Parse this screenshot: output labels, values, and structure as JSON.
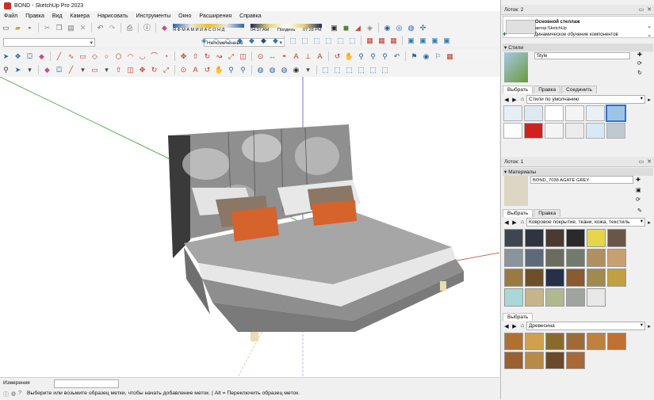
{
  "window": {
    "title": "BOND - SketchUp Pro 2023"
  },
  "menu": [
    "Файл",
    "Правка",
    "Вид",
    "Камера",
    "Нарисовать",
    "Инструменты",
    "Окно",
    "Расширения",
    "Справка"
  ],
  "shadow": {
    "months": "Я Ф М А М И И А С О Н Д",
    "time_left": "04:37 AM",
    "noon": "Полдень",
    "time_right": "07:28 PM"
  },
  "layer_select": "Непомеченные",
  "status": {
    "measure_label": "Измерения",
    "hint": "Выберите или возьмите образец метки, чтобы начать добавление меток. | Alt = Переключить образец меток."
  },
  "tray2": {
    "title": "Лоток: 2",
    "component_name": "Основной стеллаж",
    "component_author": "автор:SketchUp",
    "component_desc": "Динамическое обучение компонентов",
    "styles_header": "Стили",
    "style_name": "Style",
    "tabs": [
      "Выбрать",
      "Правка",
      "Соединить"
    ],
    "style_dropdown": "Стили по умолчанию"
  },
  "tray1": {
    "title": "Лоток: 1",
    "materials_header": "Материалы",
    "material_name": "BOND_7038 AGATE GREY",
    "tabs": [
      "Выбрать",
      "Правка"
    ],
    "material_dropdown": "Ковровое покрытие, ткани, кожа, текстиль",
    "lower_tab": "Выбрать",
    "lower_dropdown": "Древесина"
  },
  "swatches": {
    "fabrics": [
      "#3f4650",
      "#2e3540",
      "#4a3a30",
      "#2a2a2a",
      "#e6d64a",
      "#6a5648",
      "#8a949a",
      "#5f6a78",
      "#6b6b60",
      "#727a70",
      "#b09060",
      "#c8a070",
      "#9a7a40",
      "#6e4f2a",
      "#25304a",
      "#8a5a30",
      "#a08a50",
      "#c0a040",
      "#a8d8d8",
      "#c8b48a",
      "#b0b890",
      "#a0a4a0",
      "#e8e8e8"
    ],
    "woods": [
      "#b07030",
      "#d0a050",
      "#8a6a2a",
      "#a06a38",
      "#c08040",
      "#c07030",
      "#9a6030",
      "#b88a48",
      "#6a4a28",
      "#a86838"
    ],
    "styles": [
      "#e6eef6",
      "#dde8f0",
      "#ffffff",
      "#f4f4f4",
      "#eaf0f6",
      "#9cc4e4",
      "#ffffff",
      "#d02020",
      "#f4f4f4",
      "#ececec",
      "#d8e8f4",
      "#c0c8d0"
    ]
  }
}
